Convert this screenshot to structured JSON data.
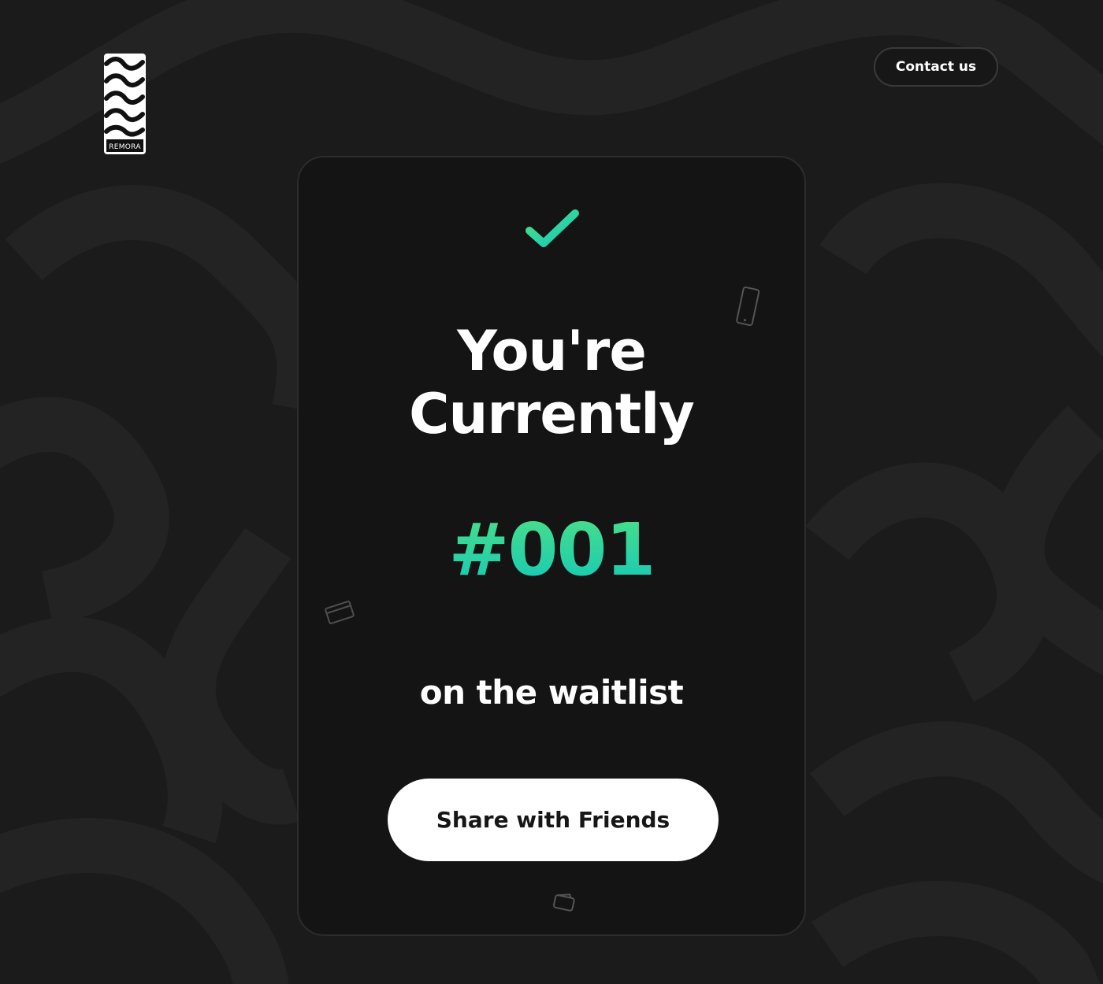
{
  "header": {
    "logo_text": "REMORA",
    "contact_label": "Contact us"
  },
  "card": {
    "status_icon": "check-icon",
    "headline_line1": "You're",
    "headline_line2": "Currently",
    "position": "#001",
    "subtext": "on the waitlist",
    "share_label": "Share with Friends"
  },
  "decorations": [
    "phone-icon",
    "credit-card-icon",
    "wallet-icon"
  ],
  "colors": {
    "background": "#1b1b1b",
    "card": "#141414",
    "accent_start": "#4ee086",
    "accent_end": "#12c8b8",
    "button": "#ffffff"
  }
}
